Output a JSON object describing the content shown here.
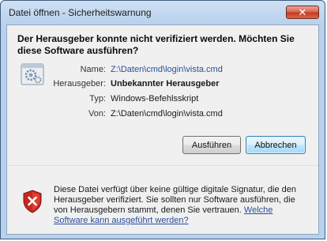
{
  "window": {
    "title": "Datei öffnen - Sicherheitswarnung",
    "close_glyph": "✕"
  },
  "question": "Der Herausgeber konnte nicht verifiziert werden. Möchten Sie diese Software ausführen?",
  "details": {
    "name_label": "Name:",
    "name_value": "Z:\\Daten\\cmd\\login\\vista.cmd",
    "publisher_label": "Herausgeber:",
    "publisher_value": "Unbekannter Herausgeber",
    "type_label": "Typ:",
    "type_value": "Windows-Befehlsskript",
    "from_label": "Von:",
    "from_value": "Z:\\Daten\\cmd\\login\\vista.cmd"
  },
  "buttons": {
    "run_label": "Ausführen",
    "cancel_label": "Abbrechen"
  },
  "warning": {
    "text": "Diese Datei verfügt über keine gültige digitale Signatur, die den Herausgeber verifiziert. Sie sollten nur Software ausführen, die von Herausgebern stammt, denen Sie vertrauen. ",
    "link_text": "Welche Software kann ausgeführt werden?"
  },
  "icons": {
    "file": "script-file-icon",
    "shield": "security-shield-error-icon"
  },
  "colors": {
    "link": "#2a4f9a",
    "shield_red": "#c8281e"
  }
}
